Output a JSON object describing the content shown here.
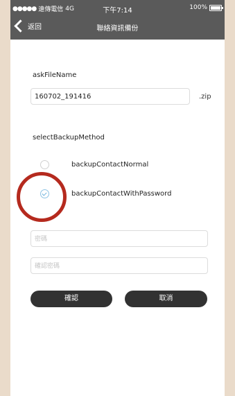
{
  "status_bar": {
    "signal": "●●●●●",
    "carrier": "遠傳電信",
    "network": "4G",
    "time": "下午7:14",
    "battery": "100%",
    "battery_level": 1.0
  },
  "header": {
    "back_label": "返回",
    "title": "聯絡資訊備份"
  },
  "form": {
    "file_name_label": "askFileName",
    "file_name_value": "160702_191416",
    "file_ext": ".zip",
    "method_label": "selectBackupMethod",
    "options": [
      {
        "label": "backupContactNormal",
        "selected": false
      },
      {
        "label": "backupContactWithPassword",
        "selected": true
      }
    ],
    "password_placeholder": "密碼",
    "confirm_password_placeholder": "確認密碼"
  },
  "buttons": {
    "confirm": "確認",
    "cancel": "取消"
  },
  "colors": {
    "background": "#eadbca",
    "header": "#5a5a5a",
    "button": "#323232",
    "highlight": "#b52a1e",
    "check": "#6ab0dc"
  }
}
